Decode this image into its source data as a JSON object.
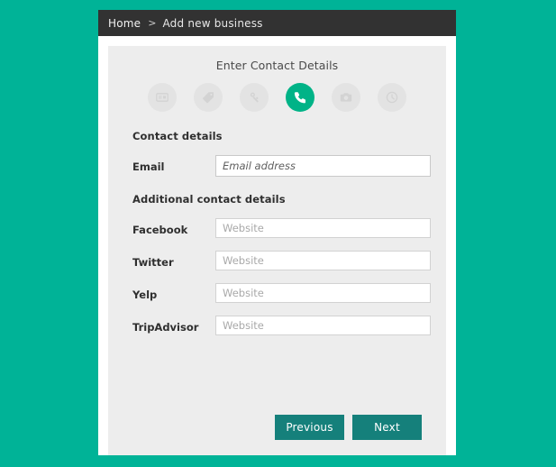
{
  "page": {
    "background_color": "#00b397",
    "card_background": "#ffffff",
    "panel_background": "#ededed"
  },
  "breadcrumb": {
    "home_label": "Home",
    "separator": ">",
    "current_label": "Add new business"
  },
  "wizard": {
    "title": "Enter Contact Details",
    "active_step_index": 3,
    "active_color": "#00b387",
    "inactive_color": "#e3e3e3",
    "steps": [
      {
        "icon": "business-card-icon",
        "label": "Business details"
      },
      {
        "icon": "tag-icon",
        "label": "Categories"
      },
      {
        "icon": "person-pin-icon",
        "label": "Location"
      },
      {
        "icon": "phone-icon",
        "label": "Contact details"
      },
      {
        "icon": "camera-icon",
        "label": "Photos"
      },
      {
        "icon": "clock-icon",
        "label": "Opening hours"
      }
    ]
  },
  "form": {
    "contact_section_title": "Contact details",
    "additional_section_title": "Additional contact details",
    "fields": [
      {
        "label": "Email",
        "value": "",
        "placeholder": "Email address",
        "style": "italic"
      },
      {
        "label": "Facebook",
        "value": "",
        "placeholder": "Website",
        "style": "normal"
      },
      {
        "label": "Twitter",
        "value": "",
        "placeholder": "Website",
        "style": "normal"
      },
      {
        "label": "Yelp",
        "value": "",
        "placeholder": "Website",
        "style": "normal"
      },
      {
        "label": "TripAdvisor",
        "value": "",
        "placeholder": "Website",
        "style": "normal"
      }
    ]
  },
  "footer": {
    "previous_label": "Previous",
    "next_label": "Next",
    "button_color": "#15807b"
  }
}
